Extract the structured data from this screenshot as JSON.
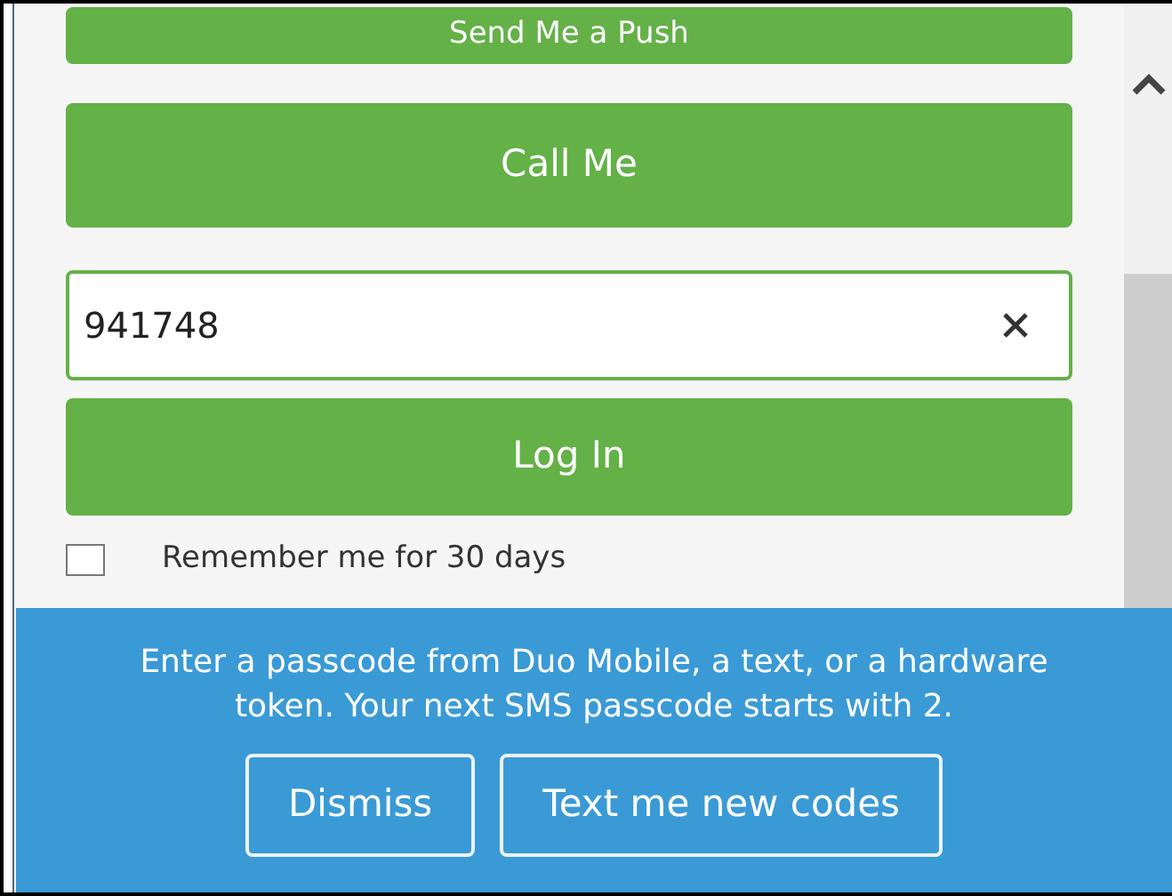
{
  "buttons": [
    {
      "label": "Send Me a Push"
    },
    {
      "label": "Call Me"
    }
  ],
  "passcode": {
    "value": "941748"
  },
  "login_button": {
    "label": "Log In"
  },
  "remember": {
    "label": "Remember me for 30 days",
    "checked": false
  },
  "notice": {
    "message": "Enter a passcode from Duo Mobile, a text, or a hardware token. Your next SMS passcode starts with 2.",
    "buttons": [
      "Dismiss",
      "Text me new codes"
    ]
  }
}
